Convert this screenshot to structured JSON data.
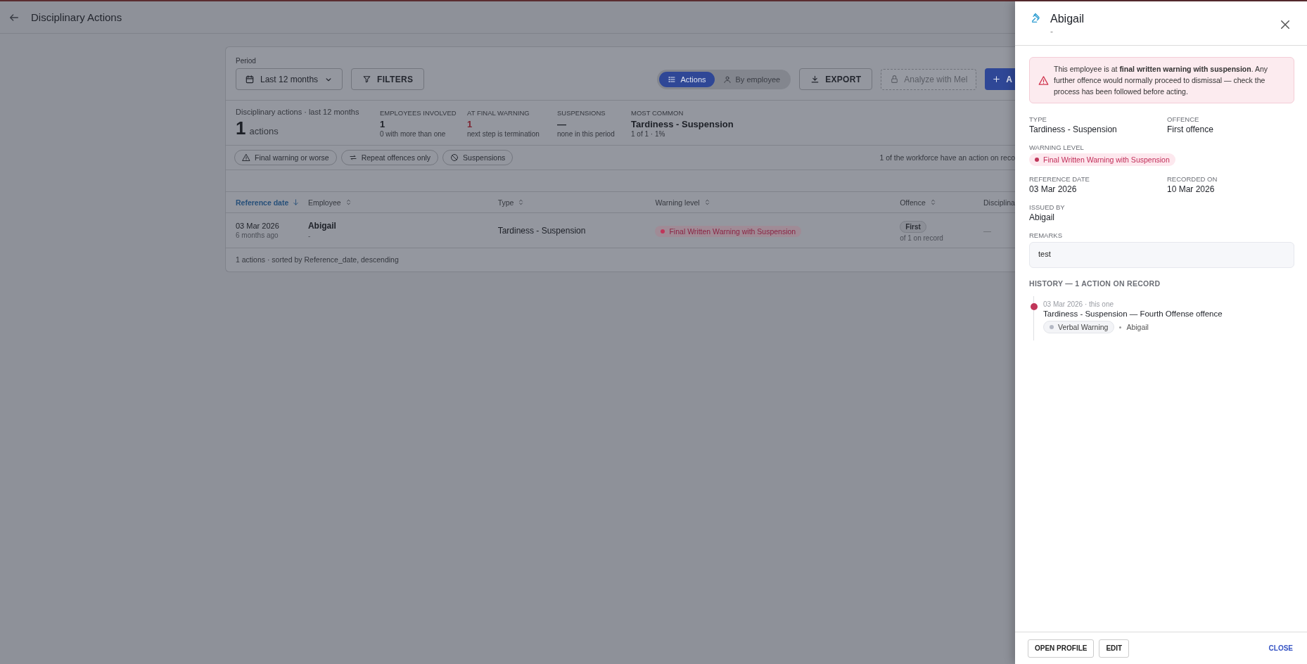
{
  "header": {
    "title": "Disciplinary Actions"
  },
  "toolbar": {
    "period_label": "Period",
    "period_value": "Last 12 months",
    "filters_button": "FILTERS",
    "view_toggle": [
      {
        "label": "Actions",
        "kind": "list",
        "selected": true
      },
      {
        "label": "By employee",
        "kind": "person",
        "selected": false
      }
    ],
    "export_button": "EXPORT",
    "analyze_button": {
      "label": "Analyze with Mel",
      "disabled": true
    },
    "add_button": "A"
  },
  "summary": {
    "caption": "Disciplinary actions · last 12 months",
    "count": "1",
    "unit": "actions"
  },
  "stats": [
    {
      "label": "EMPLOYEES INVOLVED",
      "value": "1",
      "note": "0 with more than one",
      "highlight": false
    },
    {
      "label": "AT FINAL WARNING",
      "value": "1",
      "note": "next step is termination",
      "highlight": true
    },
    {
      "label": "SUSPENSIONS",
      "value": "—",
      "note": "none in this period",
      "highlight": false
    },
    {
      "label": "MOST COMMON",
      "value": "Tardiness - Suspension",
      "note": "1 of 1 · 1%",
      "highlight": false
    }
  ],
  "quick_filters": [
    {
      "label": "Final warning or worse",
      "kind": "warning"
    },
    {
      "label": "Repeat offences only",
      "kind": "repeat"
    },
    {
      "label": "Suspensions",
      "kind": "blocked"
    }
  ],
  "workforce_note": "1 of the workforce have an action on reco",
  "table": {
    "columns": [
      {
        "label": "Reference date",
        "sortable": true,
        "sorted": true
      },
      {
        "label": "Employee",
        "sortable": true,
        "sorted": false
      },
      {
        "label": "Type",
        "sortable": true,
        "sorted": false
      },
      {
        "label": "Warning level",
        "sortable": true,
        "sorted": false
      },
      {
        "label": "Offence",
        "sortable": true,
        "sorted": false
      },
      {
        "label": "Disciplina",
        "sorted": false
      }
    ],
    "rows": [
      {
        "date": "03 Mar 2026",
        "ago": "6 months ago",
        "employee": "Abigail",
        "employee_sub": "-",
        "type": "Tardiness - Suspension",
        "warning": {
          "label": "Final Written Warning with Suspension",
          "color": "#c0365a"
        },
        "offence": "First",
        "offence_note": "of 1 on record",
        "column_6": "—"
      }
    ]
  },
  "table_footer": "1 actions · sorted by Reference_date, descending",
  "drawer": {
    "title": "Abigail",
    "subtitle": "-",
    "alert": "This employee is at **final written warning with suspension**. Any further offence would normally proceed to dismissal — check the process has been followed before acting.",
    "fields": [
      {
        "label": "TYPE",
        "kind": "text",
        "value": "Tardiness - Suspension"
      },
      {
        "label": "OFFENCE",
        "kind": "text",
        "value": "First offence"
      },
      {
        "label": "WARNING LEVEL",
        "kind": "chip",
        "value": "Final Written Warning with Suspension",
        "color": "#c0365a"
      },
      {
        "label": "REFERENCE DATE",
        "kind": "text",
        "value": "03 Mar 2026"
      },
      {
        "label": "RECORDED ON",
        "kind": "text",
        "value": "10 Mar 2026"
      },
      {
        "label": "ISSUED BY",
        "kind": "text",
        "value": "Abigail"
      }
    ],
    "remarks": {
      "label": "REMARKS",
      "value": "test"
    },
    "history": {
      "title": "HISTORY — 1 ACTION ON RECORD",
      "items": [
        {
          "meta": "03 Mar 2026 · this one",
          "title": "Tardiness - Suspension — Fourth Offense offence",
          "level": {
            "label": "Verbal Warning",
            "color": "#b4b8c4"
          },
          "by": "Abigail",
          "color": "#c0365a"
        }
      ]
    },
    "buttons": [
      "OPEN PROFILE",
      "EDIT"
    ],
    "close_link": "CLOSE"
  }
}
